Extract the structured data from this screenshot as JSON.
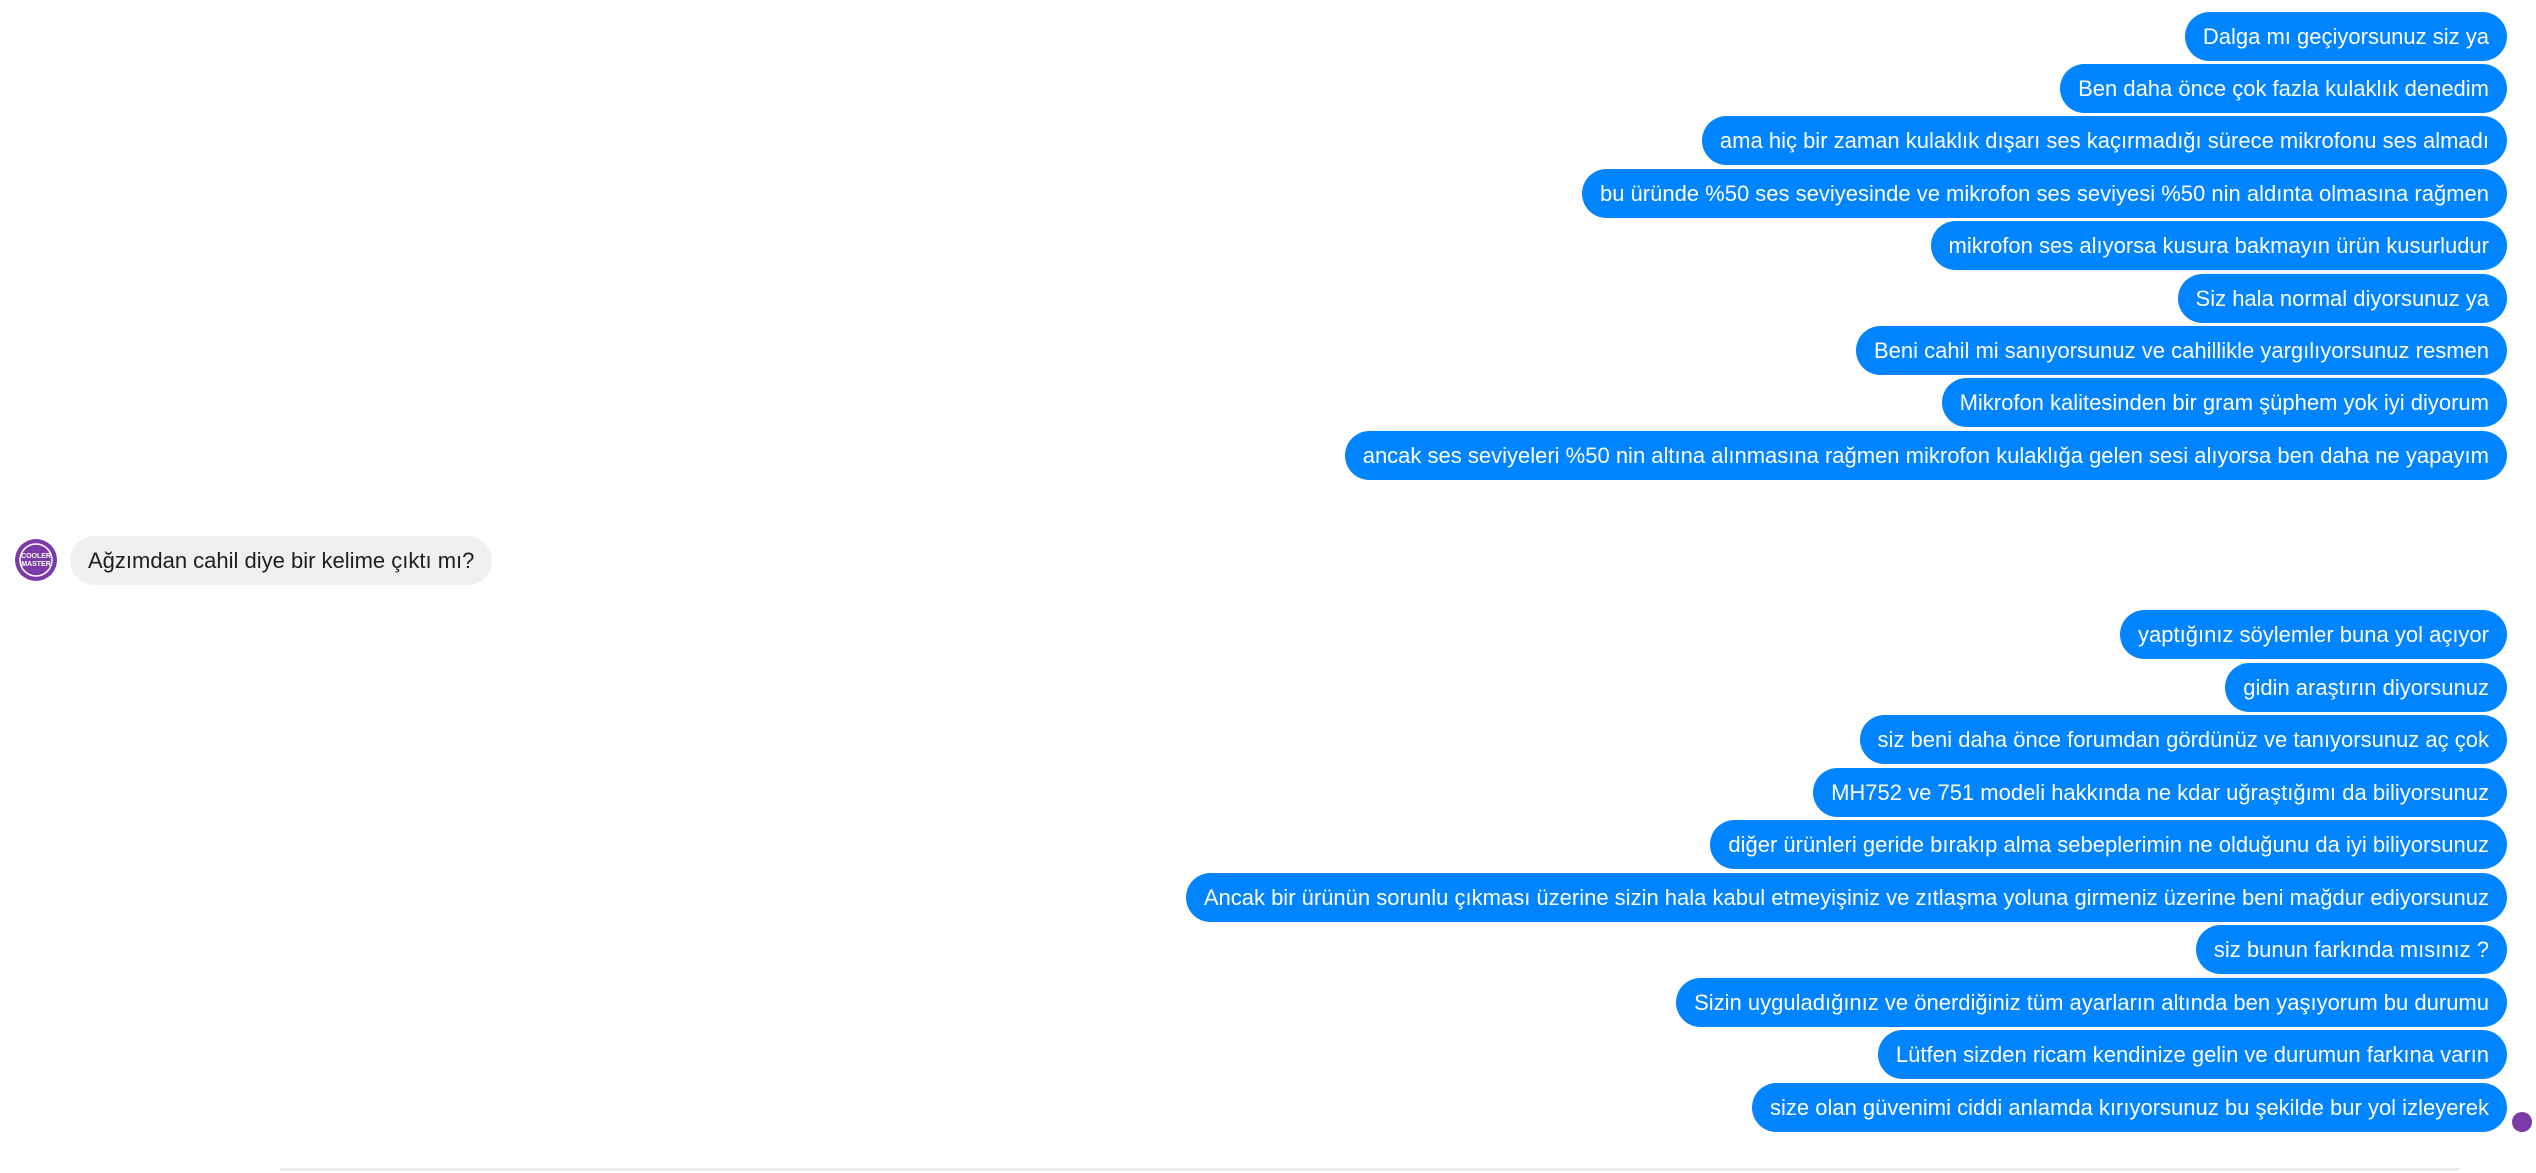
{
  "outgoing_group_1": [
    "Dalga mı geçiyorsunuz siz ya",
    "Ben daha önce çok fazla kulaklık denedim",
    "ama hiç bir zaman kulaklık dışarı ses kaçırmadığı sürece mikrofonu ses almadı",
    "bu üründe %50 ses seviyesinde ve mikrofon ses seviyesi %50 nin aldınta olmasına rağmen",
    "mikrofon ses alıyorsa kusura bakmayın ürün kusurludur",
    "Siz hala normal diyorsunuz ya",
    "Beni cahil mi sanıyorsunuz ve cahillikle yargılıyorsunuz resmen",
    "Mikrofon kalitesinden bir gram şüphem yok iyi diyorum",
    "ancak ses seviyeleri %50 nin altına alınmasına rağmen mikrofon kulaklığa gelen sesi alıyorsa ben daha ne yapayım"
  ],
  "incoming": {
    "avatar_icon": "cooler-master-logo-icon",
    "avatar_text": "COOLER MASTER",
    "message": "Ağzımdan cahil diye bir kelime çıktı mı?"
  },
  "outgoing_group_2": [
    "yaptığınız söylemler buna yol açıyor",
    "gidin araştırın diyorsunuz",
    "siz beni daha önce forumdan gördünüz ve tanıyorsunuz aç çok",
    "MH752 ve 751 modeli hakkında ne kdar uğraştığımı da biliyorsunuz",
    "diğer ürünleri geride bırakıp alma sebeplerimin ne olduğunu da iyi biliyorsunuz",
    "Ancak bir ürünün sorunlu çıkması üzerine sizin hala kabul etmeyişiniz ve zıtlaşma yoluna girmeniz üzerine beni mağdur ediyorsunuz",
    "siz bunun farkında mısınız ?",
    "Sizin uyguladığınız ve önerdiğiniz tüm ayarların altında ben yaşıyorum bu durumu",
    "Lütfen sizden ricam kendinize gelin ve durumun farkına varın",
    "size olan güvenimi ciddi anlamda kırıyorsunuz bu şekilde bur yol izleyerek"
  ],
  "colors": {
    "outgoing_bubble": "#0084ff",
    "incoming_bubble": "#f0f0f0",
    "avatar": "#7b3aa8"
  }
}
